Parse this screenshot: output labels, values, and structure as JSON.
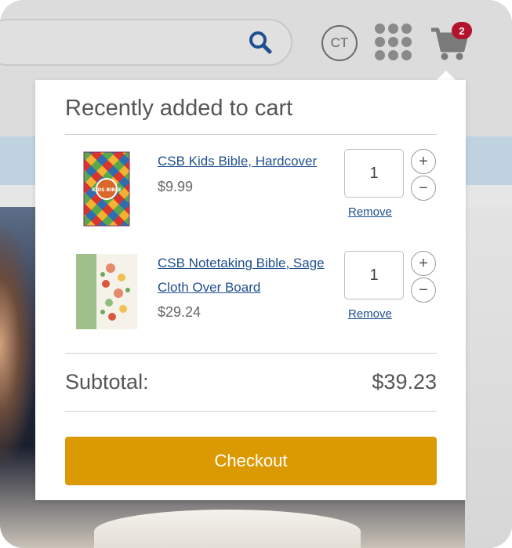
{
  "header": {
    "search_icon": "search-icon",
    "avatar_initials": "CT",
    "apps_icon": "grid-icon",
    "cart_icon": "cart-icon",
    "cart_count": "2",
    "badge_color": "#b3132b"
  },
  "cart": {
    "title": "Recently added to cart",
    "items": [
      {
        "name": "CSB Kids Bible, Hardcover",
        "price": "$9.99",
        "quantity": "1",
        "increment_label": "+",
        "decrement_label": "−",
        "remove_label": "Remove",
        "cover_label": "KIDS BIBLE"
      },
      {
        "name": "CSB Notetaking Bible, Sage Cloth Over Board",
        "price": "$29.24",
        "quantity": "1",
        "increment_label": "+",
        "decrement_label": "−",
        "remove_label": "Remove"
      }
    ],
    "subtotal_label": "Subtotal:",
    "subtotal_value": "$39.23",
    "checkout_label": "Checkout",
    "checkout_color": "#dc9a02",
    "link_color": "#1f4f8f"
  }
}
